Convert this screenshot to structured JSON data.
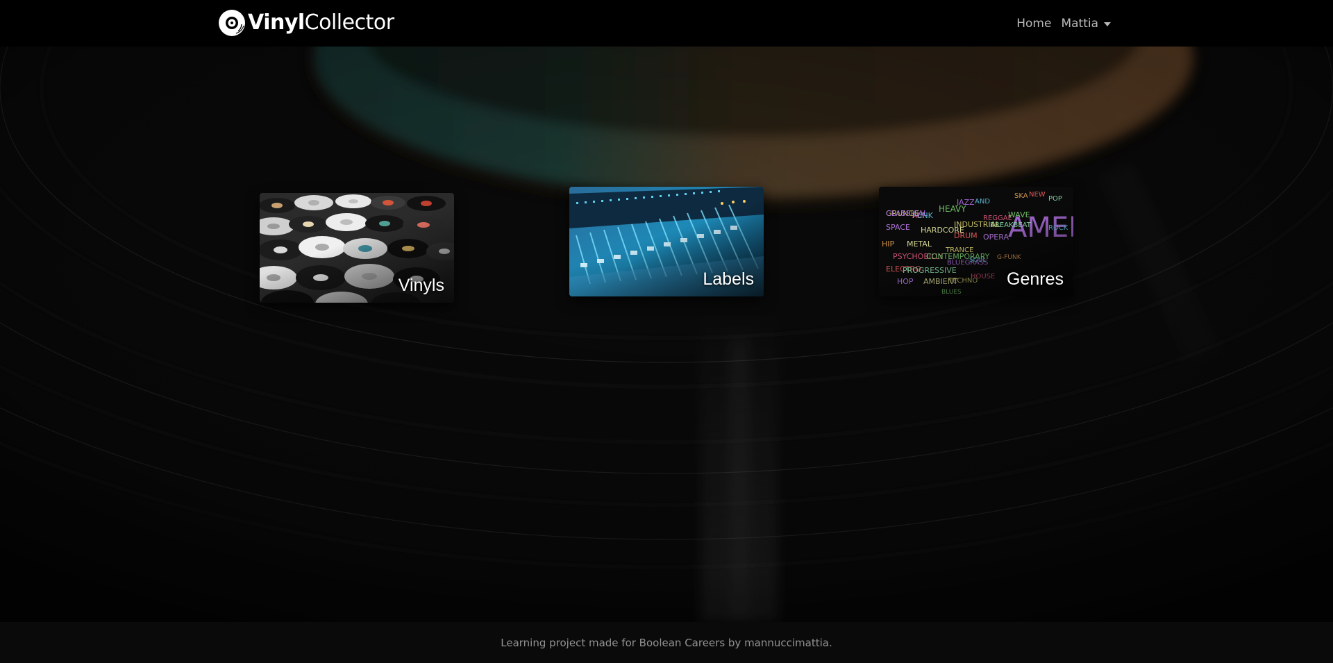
{
  "navbar": {
    "brand_bold": "Vinyl",
    "brand_regular": "Collector",
    "logo_icon": "vinyl-record-icon",
    "links": {
      "home": "Home",
      "user": "Mattia"
    },
    "user_dropdown_icon": "caret-down-icon"
  },
  "cards": [
    {
      "label": "Vinyls",
      "image": "vinyl-records-photo"
    },
    {
      "label": "Labels",
      "image": "mixing-console-photo"
    },
    {
      "label": "Genres",
      "image": "genre-word-cloud"
    }
  ],
  "genre_words": [
    "GRUNGE",
    "ALT",
    "HEAVY",
    "JAZZ",
    "AND",
    "SKA",
    "NEW",
    "POP",
    "SPACE",
    "HARDCORE",
    "INDUSTRIAL",
    "REGGAE",
    "WAVE",
    "AMERICANA",
    "ROCK",
    "HIP",
    "DRUM",
    "BREAKBEAT",
    "OPERA",
    "METAL",
    "TRANCE",
    "PSYCHOBILLY",
    "CONTEMPORARY",
    "BLUEGRASS",
    "SOUL",
    "G-FUNK",
    "ELECTRO",
    "PROGRESSIVE",
    "HOP",
    "AMBIENT",
    "TECHNO",
    "HOUSE",
    "BLUES",
    "CLASSICAL",
    "FUNK"
  ],
  "footer": {
    "text": "Learning project made for Boolean Careers by mannuccimattia."
  },
  "colors": {
    "navbar_bg": "#000000",
    "footer_bg": "#0a0a0a",
    "label_accent": "#ffffff",
    "record_label_orange": "#c8824a",
    "record_label_teal": "#2c6e63"
  }
}
